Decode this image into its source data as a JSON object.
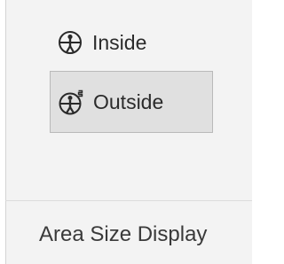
{
  "ribbon_group": {
    "name": "Area Size Display",
    "options": [
      {
        "label": "Inside",
        "icon": "person-circle-icon",
        "selected": false
      },
      {
        "label": "Outside",
        "icon": "person-circle-outside-icon",
        "selected": true
      }
    ]
  },
  "colors": {
    "panel_background": "#f3f3f3",
    "selected_background": "#e0e0e0",
    "selected_border": "#b9b9b9",
    "text": "#2b2b2b"
  }
}
